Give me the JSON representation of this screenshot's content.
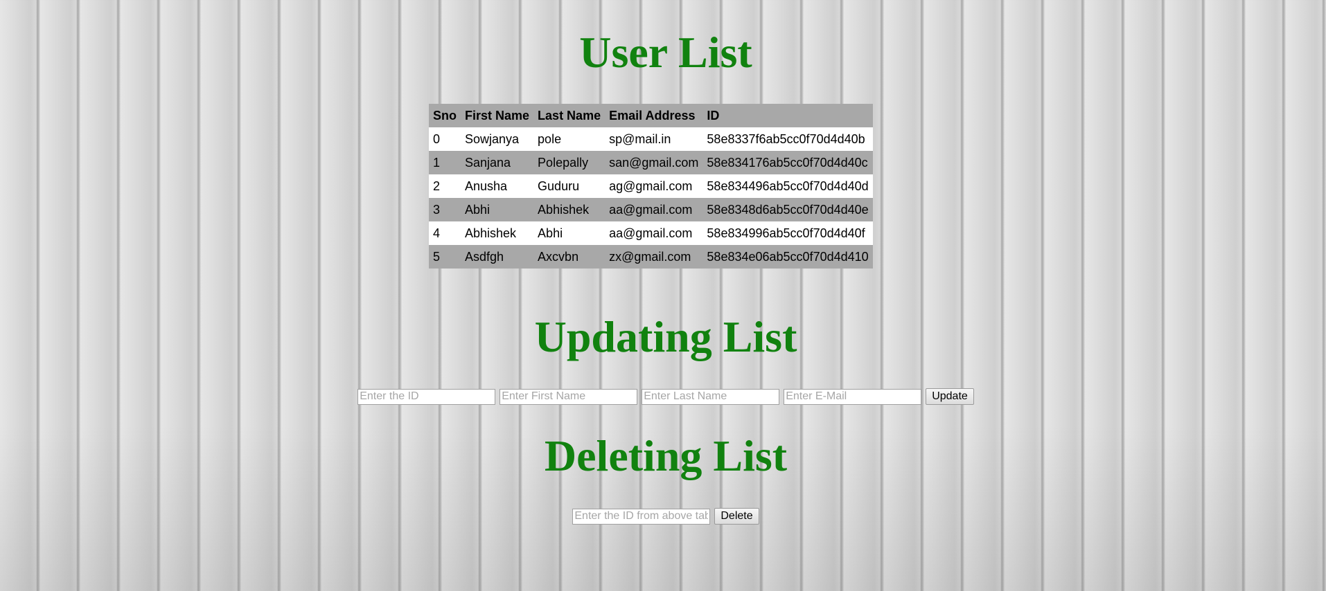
{
  "headings": {
    "users": "User List",
    "update": "Updating List",
    "delete": "Deleting List"
  },
  "table": {
    "columns": [
      "Sno",
      "First Name",
      "Last Name",
      "Email Address",
      "ID"
    ],
    "rows": [
      [
        "0",
        "Sowjanya",
        "pole",
        "sp@mail.in",
        "58e8337f6ab5cc0f70d4d40b"
      ],
      [
        "1",
        "Sanjana",
        "Polepally",
        "san@gmail.com",
        "58e834176ab5cc0f70d4d40c"
      ],
      [
        "2",
        "Anusha",
        "Guduru",
        "ag@gmail.com",
        "58e834496ab5cc0f70d4d40d"
      ],
      [
        "3",
        "Abhi",
        "Abhishek",
        "aa@gmail.com",
        "58e8348d6ab5cc0f70d4d40e"
      ],
      [
        "4",
        "Abhishek",
        "Abhi",
        "aa@gmail.com",
        "58e834996ab5cc0f70d4d40f"
      ],
      [
        "5",
        "Asdfgh",
        "Axcvbn",
        "zx@gmail.com",
        "58e834e06ab5cc0f70d4d410"
      ]
    ]
  },
  "update_form": {
    "id_placeholder": "Enter the ID",
    "first_name_placeholder": "Enter First Name",
    "last_name_placeholder": "Enter Last Name",
    "email_placeholder": "Enter E-Mail",
    "button_label": "Update"
  },
  "delete_form": {
    "id_placeholder": "Enter the ID from above table",
    "button_label": "Delete"
  },
  "colors": {
    "heading": "#11820f",
    "row_alt": "#a8a8a8",
    "row_plain": "#ffffff"
  }
}
